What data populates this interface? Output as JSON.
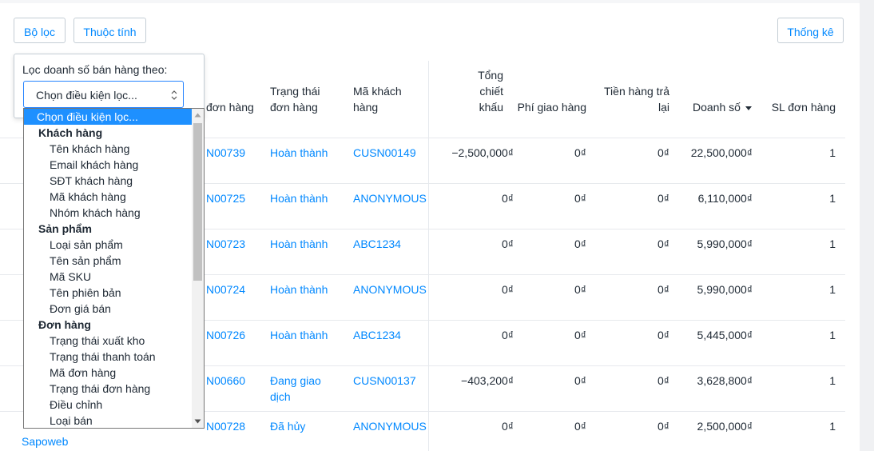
{
  "toolbar": {
    "filter_label": "Bộ lọc",
    "attribute_label": "Thuộc tính",
    "stats_label": "Thống kê"
  },
  "filter_popover": {
    "title": "Lọc doanh số bán hàng theo:",
    "select_value": "Chọn điều kiện lọc..."
  },
  "dropdown": {
    "items": [
      {
        "type": "selected",
        "label": "Chọn điều kiện lọc..."
      },
      {
        "type": "group",
        "label": "Khách hàng"
      },
      {
        "type": "opt",
        "label": "Tên khách hàng"
      },
      {
        "type": "opt",
        "label": "Email khách hàng"
      },
      {
        "type": "opt",
        "label": "SĐT khách hàng"
      },
      {
        "type": "opt",
        "label": "Mã khách hàng"
      },
      {
        "type": "opt",
        "label": "Nhóm khách hàng"
      },
      {
        "type": "group",
        "label": "Sản phẩm"
      },
      {
        "type": "opt",
        "label": "Loại sản phẩm"
      },
      {
        "type": "opt",
        "label": "Tên sản phẩm"
      },
      {
        "type": "opt",
        "label": "Mã SKU"
      },
      {
        "type": "opt",
        "label": "Tên phiên bản"
      },
      {
        "type": "opt",
        "label": "Đơn giá bán"
      },
      {
        "type": "group",
        "label": "Đơn hàng"
      },
      {
        "type": "opt",
        "label": "Trạng thái xuất kho"
      },
      {
        "type": "opt",
        "label": "Trạng thái thanh toán"
      },
      {
        "type": "opt",
        "label": "Mã đơn hàng"
      },
      {
        "type": "opt",
        "label": "Trạng thái đơn hàng"
      },
      {
        "type": "opt",
        "label": "Điều chỉnh"
      },
      {
        "type": "opt",
        "label": "Loại bán"
      }
    ]
  },
  "table": {
    "headers": {
      "order_code": "đơn hàng",
      "status_1": "Trạng thái",
      "status_2": "đơn hàng",
      "customer_1": "Mã khách",
      "customer_2": "hàng",
      "discount_1": "Tổng",
      "discount_2": "chiết",
      "discount_3": "khấu",
      "shipping": "Phí giao hàng",
      "returned_1": "Tiền hàng trả",
      "returned_2": "lại",
      "revenue": "Doanh số",
      "count": "SL đơn hàng"
    },
    "rows": [
      {
        "order": "N00739",
        "status": "Hoàn thành",
        "status2": "",
        "customer": "CUSN00149",
        "discount": "−2,500,000₫",
        "shipping": "0₫",
        "returned": "0₫",
        "revenue": "22,500,000₫",
        "count": "1"
      },
      {
        "order": "N00725",
        "status": "Hoàn thành",
        "status2": "",
        "customer": "ANONYMOUS",
        "discount": "0₫",
        "shipping": "0₫",
        "returned": "0₫",
        "revenue": "6,110,000₫",
        "count": "1"
      },
      {
        "order": "N00723",
        "status": "Hoàn thành",
        "status2": "",
        "customer": "ABC1234",
        "discount": "0₫",
        "shipping": "0₫",
        "returned": "0₫",
        "revenue": "5,990,000₫",
        "count": "1"
      },
      {
        "order": "N00724",
        "status": "Hoàn thành",
        "status2": "",
        "customer": "ANONYMOUS",
        "discount": "0₫",
        "shipping": "0₫",
        "returned": "0₫",
        "revenue": "5,990,000₫",
        "count": "1"
      },
      {
        "order": "N00726",
        "status": "Hoàn thành",
        "status2": "",
        "customer": "ABC1234",
        "discount": "0₫",
        "shipping": "0₫",
        "returned": "0₫",
        "revenue": "5,445,000₫",
        "count": "1"
      },
      {
        "order": "N00660",
        "status": "Đang giao",
        "status2": "dịch",
        "customer": "CUSN00137",
        "discount": "−403,200₫",
        "shipping": "0₫",
        "returned": "0₫",
        "revenue": "3,628,800₫",
        "count": "1"
      },
      {
        "order": "N00728",
        "status": "Đã hủy",
        "status2": "",
        "customer": "ANONYMOUS",
        "discount": "0₫",
        "shipping": "0₫",
        "returned": "0₫",
        "revenue": "2,500,000₫",
        "count": "1"
      }
    ],
    "bottom_fragment": "Sapoweb"
  }
}
